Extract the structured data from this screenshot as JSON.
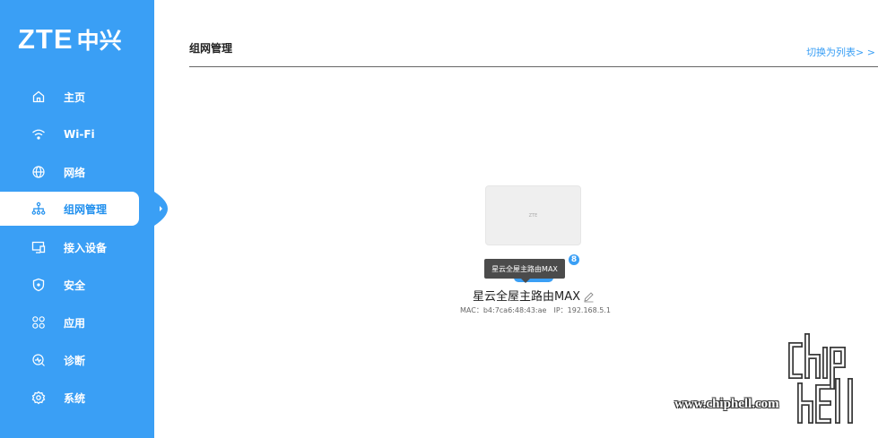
{
  "brand": {
    "logo_en": "ZTE",
    "logo_cn": "中兴"
  },
  "sidebar": {
    "items": [
      {
        "label": "主页",
        "icon": "home-icon",
        "active": false
      },
      {
        "label": "Wi-Fi",
        "icon": "wifi-icon",
        "active": false
      },
      {
        "label": "网络",
        "icon": "globe-icon",
        "active": false
      },
      {
        "label": "组网管理",
        "icon": "network-topology-icon",
        "active": true
      },
      {
        "label": "接入设备",
        "icon": "monitor-icon",
        "active": false
      },
      {
        "label": "安全",
        "icon": "shield-icon",
        "active": false
      },
      {
        "label": "应用",
        "icon": "apps-icon",
        "active": false
      },
      {
        "label": "诊断",
        "icon": "diagnosis-icon",
        "active": false
      },
      {
        "label": "系统",
        "icon": "gear-icon",
        "active": false
      }
    ]
  },
  "header": {
    "title": "组网管理",
    "switch_link": "切换为列表> >"
  },
  "device": {
    "card_brand": "ZTE",
    "badge": "8",
    "tooltip": "星云全屋主路由MAX",
    "name": "星云全屋主路由MAX",
    "mac_label": "MAC：",
    "mac": "b4:7ca6:48:43:ae",
    "ip_label": "IP：",
    "ip": "192.168.5.1"
  },
  "watermark": {
    "text": "www.chiphell.com"
  },
  "colors": {
    "sidebar": "#3a9ff5",
    "accent": "#1f8fee",
    "tooltip": "#4b4b4b"
  }
}
